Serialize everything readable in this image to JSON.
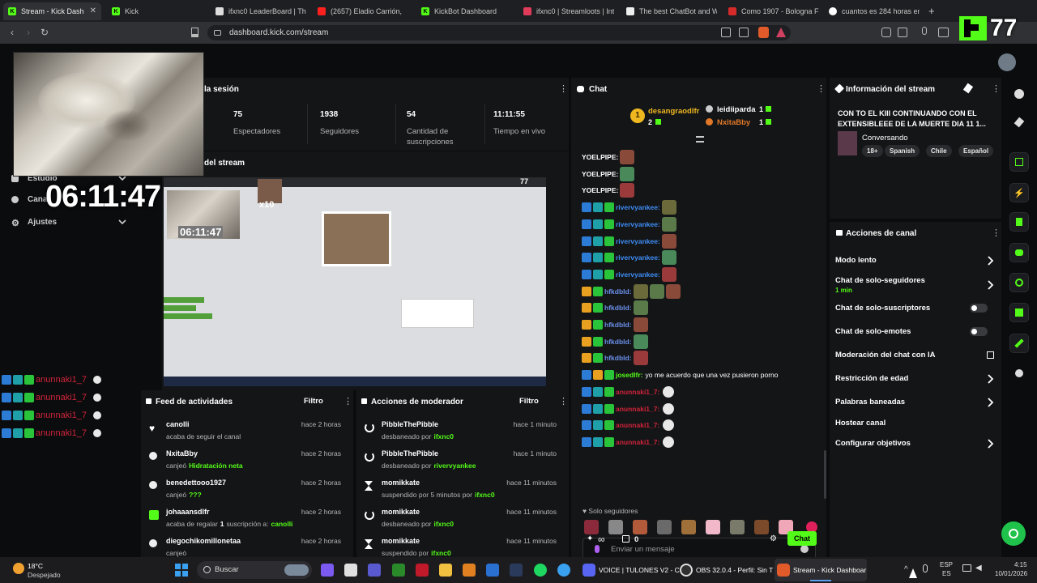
{
  "browser": {
    "tabs": [
      {
        "label": "Stream - Kick Dash",
        "active": true
      },
      {
        "label": "Kick"
      },
      {
        "label": "ifxnc0 LeaderBoard | The"
      },
      {
        "label": "(2657) Eladio Carrión,"
      },
      {
        "label": "KickBot Dashboard"
      },
      {
        "label": "ifxnc0 | Streamloots | Inte"
      },
      {
        "label": "The best ChatBot and Wid"
      },
      {
        "label": "Como 1907 - Bologna FC"
      },
      {
        "label": "cuantos es 284 horas en s"
      }
    ],
    "url": "dashboard.kick.com/stream"
  },
  "overlay": {
    "logo_count": "77",
    "clock": "06:11:47",
    "mini_clock": "06:11:47",
    "mini_logo_count": "77",
    "x_badge": "x10"
  },
  "sidebar": {
    "items": [
      {
        "label": "Estudio",
        "icon": "studio-icon"
      },
      {
        "label": "Canal",
        "icon": "channel-icon"
      },
      {
        "label": "Ajustes",
        "icon": "gear-icon"
      }
    ]
  },
  "session": {
    "title": "la sesión",
    "stats": [
      {
        "value": "75",
        "label": "Espectadores"
      },
      {
        "value": "1938",
        "label": "Seguidores"
      },
      {
        "value": "54",
        "label": "Cantidad de suscripciones"
      },
      {
        "value": "11:11:55",
        "label": "Tiempo en vivo"
      }
    ]
  },
  "preview": {
    "title": "del stream"
  },
  "left_chat": [
    {
      "user": "anunnaki1_7"
    },
    {
      "user": "anunnaki1_7"
    },
    {
      "user": "anunnaki1_7"
    },
    {
      "user": "anunnaki1_7"
    }
  ],
  "chat": {
    "title": "Chat",
    "top": [
      {
        "rank": "1",
        "user": "desangraodlfr",
        "amount": "2"
      },
      {
        "user": "leidiiparda",
        "amount": "1"
      },
      {
        "user": "NxitaBby",
        "amount": "1"
      }
    ],
    "messages": [
      {
        "user": "YOELPIPE:",
        "color": "#ffffff"
      },
      {
        "user": "YOELPIPE:",
        "color": "#ffffff"
      },
      {
        "user": "YOELPIPE:",
        "color": "#ffffff"
      },
      {
        "user": "rivervyankee:",
        "color": "#3e8ef7"
      },
      {
        "user": "rivervyankee:",
        "color": "#3e8ef7"
      },
      {
        "user": "rivervyankee:",
        "color": "#3e8ef7"
      },
      {
        "user": "rivervyankee:",
        "color": "#3e8ef7"
      },
      {
        "user": "rivervyankee:",
        "color": "#3e8ef7"
      },
      {
        "user": "hfkdbld:",
        "color": "#6a8fe8"
      },
      {
        "user": "hfkdbld:",
        "color": "#6a8fe8"
      },
      {
        "user": "hfkdbld:",
        "color": "#6a8fe8"
      },
      {
        "user": "hfkdbld:",
        "color": "#6a8fe8"
      },
      {
        "user": "hfkdbld:",
        "color": "#6a8fe8"
      },
      {
        "user": "josedlfr:",
        "color": "#53fc18",
        "text": "yo me acuerdo que una vez pusieron porno"
      },
      {
        "user": "anunnaki1_7:",
        "color": "#d0243a"
      },
      {
        "user": "anunnaki1_7:",
        "color": "#d0243a"
      },
      {
        "user": "anunnaki1_7:",
        "color": "#d0243a"
      },
      {
        "user": "anunnaki1_7:",
        "color": "#d0243a"
      }
    ],
    "followers_only": "Solo seguidores",
    "input_placeholder": "Enviar un mensaje",
    "points": "0",
    "send_label": "Chat"
  },
  "stream_info": {
    "title": "Información del stream",
    "stream_title": "CON TO EL KIII CONTINUANDO CON EL EXTENSIBLEEE DE LA MUERTE DIA 11 1...",
    "category": "Conversando",
    "tags": [
      "18+",
      "Spanish",
      "Chile",
      "Español"
    ]
  },
  "channel_actions": {
    "title": "Acciones de canal",
    "items": [
      {
        "label": "Modo lento",
        "control": "chevron"
      },
      {
        "label": "Chat de solo-seguidores",
        "sub": "1 min",
        "control": "chevron"
      },
      {
        "label": "Chat de solo-suscriptores",
        "control": "toggle"
      },
      {
        "label": "Chat de solo-emotes",
        "control": "toggle"
      },
      {
        "label": "Moderación del chat con IA",
        "control": "external"
      },
      {
        "label": "Restricción de edad",
        "control": "chevron"
      },
      {
        "label": "Palabras baneadas",
        "control": "chevron"
      },
      {
        "label": "Hostear canal",
        "control": "none"
      },
      {
        "label": "Configurar objetivos",
        "control": "chevron"
      }
    ]
  },
  "activity": {
    "title": "Feed de actividades",
    "filter": "Filtro",
    "items": [
      {
        "user": "canolli",
        "desc": "acaba de seguir el canal",
        "time": "hace 2 horas",
        "icon": "heart-icon"
      },
      {
        "user": "NxitaBby",
        "desc": "canjeó",
        "reward": "Hidratación neta",
        "time": "hace 2 horas",
        "icon": "reward-icon"
      },
      {
        "user": "benedettooo1927",
        "desc": "canjeó",
        "reward": "???",
        "time": "hace 2 horas",
        "icon": "reward-icon"
      },
      {
        "user": "johaaansdlfr",
        "desc": "acaba de regalar",
        "gift": "1",
        "desc2": "suscripción a:",
        "to": "canolli",
        "time": "hace 2 horas",
        "icon": "gift-icon"
      },
      {
        "user": "diegochikomillonetaa",
        "desc": "canjeó",
        "time": "hace 2 horas",
        "icon": "reward-icon"
      }
    ]
  },
  "modactions": {
    "title": "Acciones de moderador",
    "filter": "Filtro",
    "items": [
      {
        "user": "PibbleThePibble",
        "desc": "desbaneado por",
        "by": "ifxnc0",
        "time": "hace 1 minuto",
        "icon": "undo-icon"
      },
      {
        "user": "PibbleThePibble",
        "desc": "desbaneado por",
        "by": "rivervyankee",
        "time": "hace 1 minuto",
        "icon": "undo-icon"
      },
      {
        "user": "momikkate",
        "desc": "suspendido por 5 minutos por",
        "by": "ifxnc0",
        "time": "hace 11 minutos",
        "icon": "hourglass-icon"
      },
      {
        "user": "momikkate",
        "desc": "desbaneado por",
        "by": "ifxnc0",
        "time": "hace 11 minutos",
        "icon": "undo-icon"
      },
      {
        "user": "momikkate",
        "desc": "suspendido por",
        "by": "ifxnc0",
        "time": "hace 11 minutos",
        "icon": "hourglass-icon"
      }
    ]
  },
  "taskbar": {
    "weather_temp": "18°C",
    "weather_desc": "Despejado",
    "search": "Buscar",
    "apps": [
      {
        "label": "VOICE | TULONES V2 - C"
      },
      {
        "label": "OBS 32.0.4 - Perfil: Sin T"
      },
      {
        "label": "Stream - Kick Dashboar"
      }
    ],
    "lang": "ESP",
    "lang2": "ES",
    "time": "4:15",
    "date": "10/01/2026"
  }
}
